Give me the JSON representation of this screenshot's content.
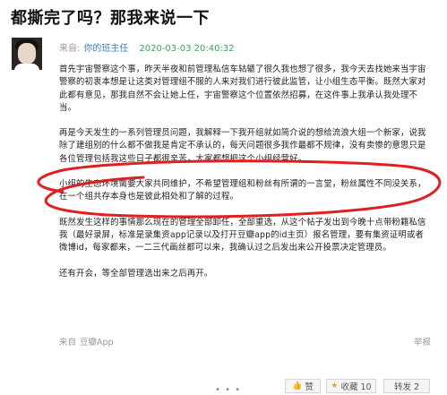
{
  "title": "都撕完了吗？那我来说一下",
  "meta": {
    "from_label": "来自:",
    "author": "你的班主任",
    "time": "2020-03-03 20:40:32"
  },
  "paragraphs": [
    "首先宇宙警察这个事，昨天半夜和前管理私信车轱辘了很久我也想了很多，我今天去找她来当宇宙警察的初衷本想是让这类对管理组不服的人来对我们进行彼此监管，让小组生态平衡。既然大家对此都有意见，那我自然不会让她上任，宇宙警察这个位置依然招募，在这件事上我承认我处理不当。",
    "再是今天发生的一系列管理员问题，我解释一下我开组就如简介说的想给流浪大组一个新家，说我除了建组别的什么都不做我是肯定不承认的，每天问题很多我作最都不规律，没有卖惨的意思只是各位管理包括我这些日子都很辛苦，大家都想把这个小组经营好。",
    "小组的生态环境需要大家共同维护，不希望管理组和粉丝有所谓的一言堂，粉丝属性不同没关系，在一个组共存本身也是彼此相处和了解的过程。",
    "既然发生这样的事情那么现在的管理全部卸任，全部重选，从这个帖子发出到今晚十点带粉籍私信我（最好录屏，标准是录集资app记录以及打开豆瓣app的id主页）报名管理，要有集资证明或者微博id，每家都来，一二三代画丝都可以来，我确认过之后发出来公开投票决定管理员。",
    "还有开会，等全部管理选出来之后再开。"
  ],
  "footer": {
    "from_label": "来自",
    "source": "豆瓣App",
    "report": "举报"
  },
  "actions": {
    "like": "赞",
    "favorite": "收藏 10",
    "share": "转发 2",
    "more": "• • •"
  },
  "colors": {
    "author_link": "#3b7dc4",
    "time": "#3aa55a",
    "annotation_circle": "#e02020"
  }
}
